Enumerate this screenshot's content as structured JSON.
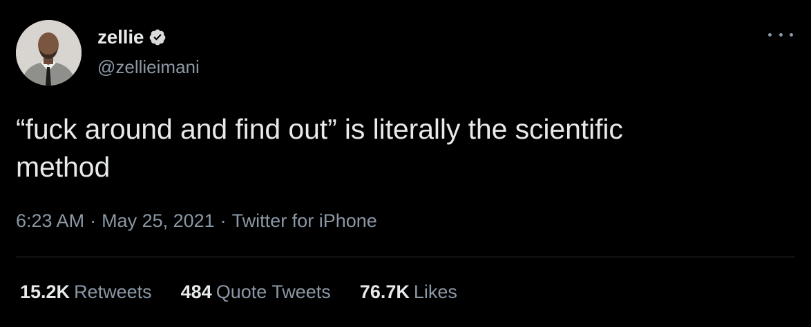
{
  "user": {
    "display_name": "zellie",
    "handle": "@zellieimani",
    "verified": true,
    "avatar_icon": "profile-photo"
  },
  "tweet": {
    "text_line1": "“fuck around and find out” is literally the scientific",
    "text_line2": "method",
    "time": "6:23 AM",
    "separator": "·",
    "date": "May 25, 2021",
    "source": "Twitter for iPhone"
  },
  "stats": {
    "retweets_count": "15.2K",
    "retweets_label": "Retweets",
    "quotes_count": "484",
    "quotes_label": "Quote Tweets",
    "likes_count": "76.7K",
    "likes_label": "Likes"
  },
  "colors": {
    "background": "#000000",
    "primary_text": "#e7e9ea",
    "secondary_text": "#8b98a5",
    "divider": "#2f3336",
    "verified_badge": "#d9d9d9"
  },
  "icons": {
    "more": "more-dots-icon",
    "verified": "verified-badge-icon"
  }
}
